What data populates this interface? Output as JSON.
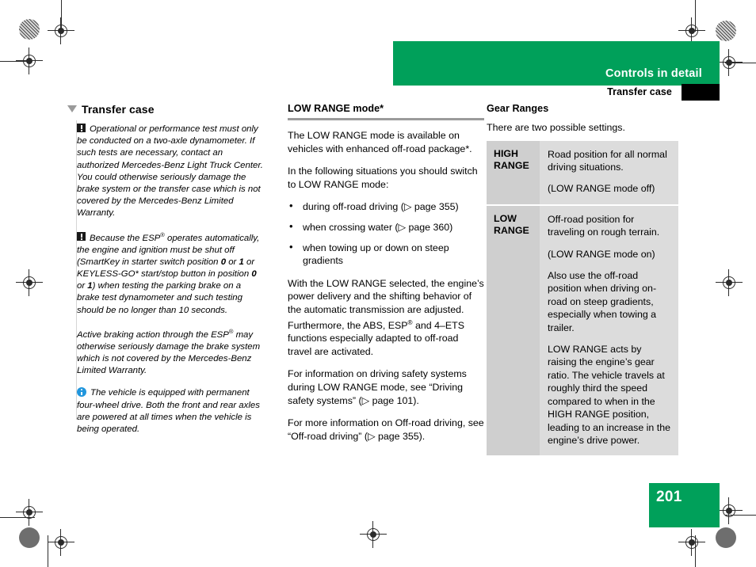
{
  "header": {
    "chapter_title": "Controls in detail",
    "section_title": "Transfer case"
  },
  "footer": {
    "page_number": "201"
  },
  "column1": {
    "heading": "Transfer case",
    "notes": [
      {
        "icon": "warning-icon",
        "text": "Operational or performance test must only be conducted on a two-axle dynamometer. If such tests are necessary, contact an authorized Mercedes-Benz Light Truck Center. You could otherwise seriously damage the brake system or the transfer case which is not covered by the Mercedes-Benz Limited Warranty."
      },
      {
        "icon": "warning-icon",
        "text_parts": {
          "p1": "Because the ESP",
          "sup1": "®",
          "p2": " operates automatically, the engine and ignition must be shut off (SmartKey in starter switch position ",
          "b1": "0",
          "p3": " or ",
          "b2": "1",
          "p4": " or KEYLESS-GO* start/stop button in position ",
          "b3": "0",
          "p5": " or ",
          "b4": "1",
          "p6": ") when testing the parking brake on a brake test dynamometer and such testing should be no longer than 10 seconds."
        }
      },
      {
        "icon": "none",
        "text_parts": {
          "p1": "Active braking action through the ESP",
          "sup1": "®",
          "p2": " may otherwise seriously damage the brake system which is not covered by the Mercedes-Benz Limited Warranty."
        }
      },
      {
        "icon": "info-icon",
        "text": "The vehicle is equipped with permanent four-wheel drive. Both the front and rear axles are powered at all times when the vehicle is being operated."
      }
    ]
  },
  "column2": {
    "heading": "LOW RANGE mode*",
    "para1": "The LOW RANGE mode is available on vehicles with enhanced off-road package*.",
    "para2": "In the following situations you should switch to LOW RANGE mode:",
    "bullets": [
      "during off-road driving (▷ page 355)",
      "when crossing water (▷ page 360)",
      "when towing up or down on steep gradients"
    ],
    "para3_parts": {
      "p1": "With the LOW RANGE selected, the engine’s power delivery and the shifting behavior of the automatic transmission are adjusted. Furthermore, the ABS, ESP",
      "sup1": "®",
      "p2": " and 4–ETS functions especially adapted to off-road travel are activated."
    },
    "para4": "For information on driving safety systems during LOW RANGE mode, see “Driving safety systems” (▷ page 101).",
    "para5": "For more information on Off-road driving, see “Off-road driving” (▷ page 355)."
  },
  "column3": {
    "heading": "Gear Ranges",
    "intro": "There are two possible settings.",
    "table": {
      "rows": [
        {
          "label": "HIGH RANGE",
          "paragraphs": [
            "Road position for all normal driving situations.",
            "(LOW RANGE mode off)"
          ]
        },
        {
          "label": "LOW RANGE",
          "paragraphs": [
            "Off-road position for traveling on rough terrain.",
            "(LOW RANGE mode on)",
            "Also use the off-road position when driving on-road on steep gradients, especially when towing a trailer.",
            "LOW RANGE acts by raising the engine’s gear ratio. The vehicle travels at roughly third the speed compared to when in the HIGH RANGE position, leading to an increase in the engine’s drive power."
          ]
        }
      ]
    }
  },
  "colors": {
    "brand_green": "#00A05A",
    "table_label_gray": "#CFCFCF",
    "table_cell_gray": "#DCDCDC",
    "rule_gray": "#9B9B9B",
    "info_blue": "#2196DD"
  }
}
